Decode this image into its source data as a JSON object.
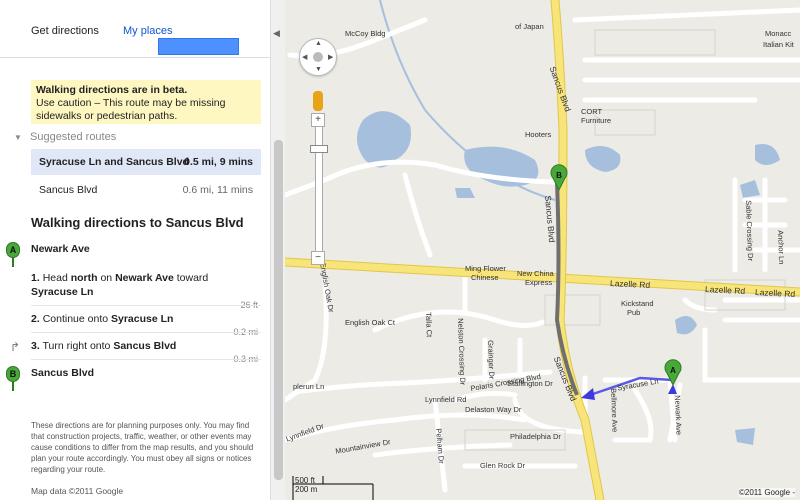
{
  "tabs": {
    "directions": "Get directions",
    "places": "My places"
  },
  "warning": {
    "title": "Walking directions are in beta.",
    "body": "Use caution – This route may be missing sidewalks or pedestrian paths."
  },
  "suggested_label": "Suggested routes",
  "routes": [
    {
      "name": "Syracuse Ln and Sancus Blvd",
      "summary": "0.5 mi, 9 mins"
    },
    {
      "name": "Sancus Blvd",
      "summary": "0.6 mi, 11 mins"
    }
  ],
  "walk_title": "Walking directions to Sancus Blvd",
  "start": {
    "marker": "A",
    "label": "Newark Ave"
  },
  "steps": [
    {
      "num": "1.",
      "pre": "Head ",
      "dir": "north",
      "mid": " on ",
      "road": "Newark Ave",
      "post": " toward",
      "road2": "Syracuse Ln",
      "dist": "26 ft"
    },
    {
      "num": "2.",
      "pre": "Continue onto ",
      "road": "Syracuse Ln",
      "dist": "0.2 mi"
    },
    {
      "num": "3.",
      "pre": "Turn right onto ",
      "road": "Sancus Blvd",
      "dist": "0.3 mi"
    }
  ],
  "end": {
    "marker": "B",
    "label": "Sancus Blvd"
  },
  "disclaimer": "These directions are for planning purposes only. You may find that construction projects, traffic, weather, or other events may cause conditions to differ from the map results, and you should plan your route accordingly. You must obey all signs or notices regarding your route.",
  "map_data": "Map data ©2011 Google",
  "map": {
    "places": {
      "mccoy": "McCoy Bldg",
      "japan": "of Japan",
      "hooters": "Hooters",
      "cort": "CORT",
      "cort2": "Furniture",
      "ming": "Ming Flower",
      "ming2": "Chinese",
      "newchina": "New China",
      "newchina2": "Express",
      "kickstand": "Kickstand",
      "kickstand2": "Pub",
      "monacc": "Monacc",
      "italian": "Italian Kit"
    },
    "roads": {
      "sancus_n": "Sancus Blvd",
      "sancus_mid": "Sancus Blvd",
      "sancus_s": "Sancus Blvd",
      "lazelle1": "Lazelle Rd",
      "lazelle2": "Lazelle Rd",
      "lazelle3": "Lazelle Rd",
      "english": "English Oak Dr",
      "engoakct": "English Oak Ct",
      "talla": "Talla Ct",
      "nelston": "Nelston Crossing Dr",
      "grainger": "Grainger Dr",
      "polaris": "Polaris Crossing Blvd",
      "staffington": "Staffington Dr",
      "syracuse": "Syracuse Ln",
      "bellmore": "Bellmore Ave",
      "newark": "Newark Ave",
      "lynnfield": "Lynnfield Rd",
      "lynnfield2": "Lynnfield Dr",
      "pelham": "Pelham Dr",
      "plerun": "plerun Ln",
      "delaston": "Delaston Way Dr",
      "mountainview": "Mountainview Dr",
      "philadelphia": "Philadelphia Dr",
      "glenrock": "Glen Rock Dr",
      "sable": "Sable Crossing Dr",
      "anchor": "Anchor Ln"
    },
    "scale_ft": "500 ft",
    "scale_m": "200 m",
    "copyright": "©2011 Google -"
  },
  "colors": {
    "road_major": "#f8e57a",
    "road_minor": "#ffffff",
    "water": "#a5bfdd",
    "route": "#6f6f6f",
    "walk_route": "#5a5ae6",
    "marker": "#48a83a"
  }
}
